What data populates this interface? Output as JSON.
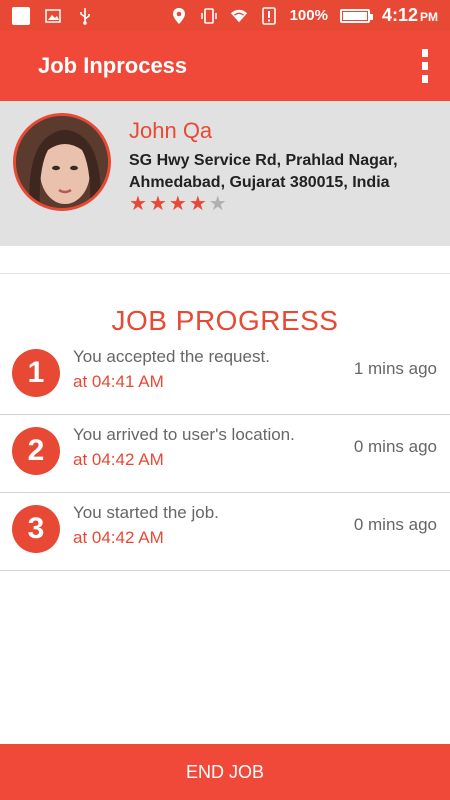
{
  "status_bar": {
    "battery": "100%",
    "time": "4:12",
    "ampm": "PM",
    "icons": [
      "square-icon",
      "image-icon",
      "usb-icon",
      "location-icon",
      "vibrate-icon",
      "wifi-icon",
      "alert-icon",
      "battery-icon"
    ]
  },
  "app_bar": {
    "title": "Job Inprocess",
    "menu_icon": "overflow-menu-icon"
  },
  "profile": {
    "name": "John Qa",
    "address": "SG Hwy Service Rd, Prahlad Nagar, Ahmedabad, Gujarat 380015, India",
    "rating": 4,
    "rating_max": 5
  },
  "progress": {
    "title": "JOB PROGRESS",
    "steps": [
      {
        "number": "1",
        "text": "You accepted the request.",
        "at": "at 04:41 AM",
        "ago": "1 mins ago"
      },
      {
        "number": "2",
        "text": "You arrived to user's location.",
        "at": "at 04:42 AM",
        "ago": "0 mins ago"
      },
      {
        "number": "3",
        "text": "You started the job.",
        "at": "at 04:42 AM",
        "ago": "0 mins ago"
      }
    ]
  },
  "footer": {
    "end_job_label": "END JOB"
  },
  "colors": {
    "accent": "#e84935",
    "profile_bg": "#e1e1e1"
  }
}
